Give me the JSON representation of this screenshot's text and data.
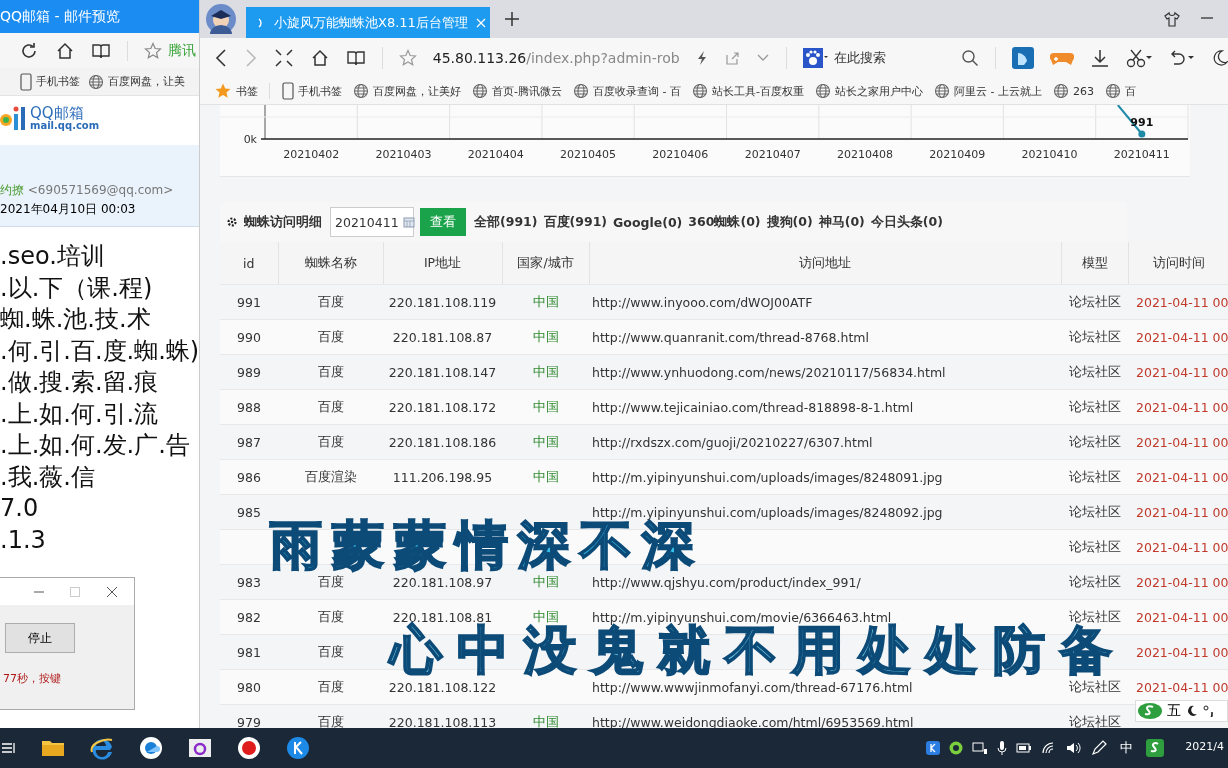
{
  "qq_window": {
    "title": "QQ邮箱 - 邮件预览",
    "toolbar_link": "腾讯",
    "bookmarks": [
      "手机书签",
      "百度网盘，让美"
    ],
    "logo": {
      "name": "QQ邮箱",
      "domain": "mail.qq.com"
    },
    "mail": {
      "sender_name": "约撩",
      "sender_email": "<690571569@qq.com>",
      "date": "2021年04月10日 00:03",
      "body_lines": [
        ".seo.培训",
        ".以.下（课.程)",
        "蜘.蛛.池.技.术",
        ".何.引.百.度.蜘.蛛)",
        ".做.搜.索.留.痕",
        ".上.如.何.引.流",
        ".上.如.何.发.广.告",
        ".我.薇.信",
        "7.0",
        ".1.3"
      ]
    }
  },
  "dialog": {
    "button": "停止",
    "message": "77秒，按键"
  },
  "browser": {
    "tabs": [
      {
        "title": "小旋风万能蜘蛛池X8.11后台管理",
        "selected": true
      }
    ],
    "address": "45.80.113.26/index.php?admin-rob",
    "search_placeholder": "在此搜索",
    "bookmarks": [
      "书签",
      "手机书签",
      "百度网盘，让美好",
      "首页-腾讯微云",
      "百度收录查询 - 百",
      "站长工具-百度权重",
      "站长之家用户中心",
      "阿里云 - 上云就上",
      "263",
      "百"
    ]
  },
  "chart": {
    "x_labels": [
      "20210402",
      "20210403",
      "20210404",
      "20210405",
      "20210406",
      "20210407",
      "20210408",
      "20210409",
      "20210410",
      "20210411"
    ],
    "y_tick_labels": [
      "0k"
    ],
    "point_label": "991"
  },
  "spider_log": {
    "title": "蜘蛛访问明细",
    "date": "20210411",
    "view_button": "查看",
    "filters": [
      "全部(991)",
      "百度(991)",
      "Google(0)",
      "360蜘蛛(0)",
      "搜狗(0)",
      "神马(0)",
      "今日头条(0)"
    ],
    "columns": [
      "id",
      "蜘蛛名称",
      "IP地址",
      "国家/城市",
      "访问地址",
      "模型",
      "访问时间"
    ],
    "rows": [
      {
        "id": "991",
        "spider": "百度",
        "ip": "220.181.108.119",
        "country": "中国",
        "url": "http://www.inyooo.com/dWOJ00ATF",
        "model": "论坛社区",
        "time": "2021-04-11 00"
      },
      {
        "id": "990",
        "spider": "百度",
        "ip": "220.181.108.87",
        "country": "中国",
        "url": "http://www.quanranit.com/thread-8768.html",
        "model": "论坛社区",
        "time": "2021-04-11 00"
      },
      {
        "id": "989",
        "spider": "百度",
        "ip": "220.181.108.147",
        "country": "中国",
        "url": "http://www.ynhuodong.com/news/20210117/56834.html",
        "model": "论坛社区",
        "time": "2021-04-11 00"
      },
      {
        "id": "988",
        "spider": "百度",
        "ip": "220.181.108.172",
        "country": "中国",
        "url": "http://www.tejicainiao.com/thread-818898-8-1.html",
        "model": "论坛社区",
        "time": "2021-04-11 00"
      },
      {
        "id": "987",
        "spider": "百度",
        "ip": "220.181.108.186",
        "country": "中国",
        "url": "http://rxdszx.com/guoji/20210227/6307.html",
        "model": "论坛社区",
        "time": "2021-04-11 00"
      },
      {
        "id": "986",
        "spider": "百度渲染",
        "ip": "111.206.198.95",
        "country": "中国",
        "url": "http://m.yipinyunshui.com/uploads/images/8248091.jpg",
        "model": "论坛社区",
        "time": "2021-04-11 00"
      },
      {
        "id": "985",
        "url": "http://m.yipinyunshui.com/uploads/images/8248092.jpg",
        "model": "论坛社区",
        "time": "2021-04-11 00"
      },
      {
        "model": "论坛社区",
        "time": "2021-04-11 00"
      },
      {
        "id": "983",
        "spider": "百度",
        "ip": "220.181.108.97",
        "country": "中国",
        "url": "http://www.qjshyu.com/product/index_991/",
        "model": "论坛社区",
        "time": "2021-04-11 00"
      },
      {
        "id": "982",
        "spider": "百度",
        "ip": "220.181.108.81",
        "country": "中国",
        "url": "http://m.yipinyunshui.com/movie/6366463.html",
        "model": "论坛社区",
        "time": "2021-04-11 00"
      },
      {
        "id": "981",
        "spider": "百度",
        "time": "2021-04-11 00"
      },
      {
        "id": "980",
        "spider": "百度",
        "ip": "220.181.108.122",
        "url": "http://www.wwwjinmofanyi.com/thread-67176.html",
        "model": "论坛社区",
        "time": "2021-04-11 00"
      },
      {
        "id": "979",
        "spider": "百度",
        "ip": "220.181.108.113",
        "country": "中国",
        "url": "http://www.weidongdiaoke.com/html/6953569.html",
        "model": "论坛社区"
      }
    ]
  },
  "ime_toolbar": {
    "mode": "五"
  },
  "taskbar": {
    "input_language": "中",
    "clock": "2021/4"
  },
  "captions": [
    "雨蒙蒙情深不深",
    "心中没鬼就不用处处防备"
  ]
}
